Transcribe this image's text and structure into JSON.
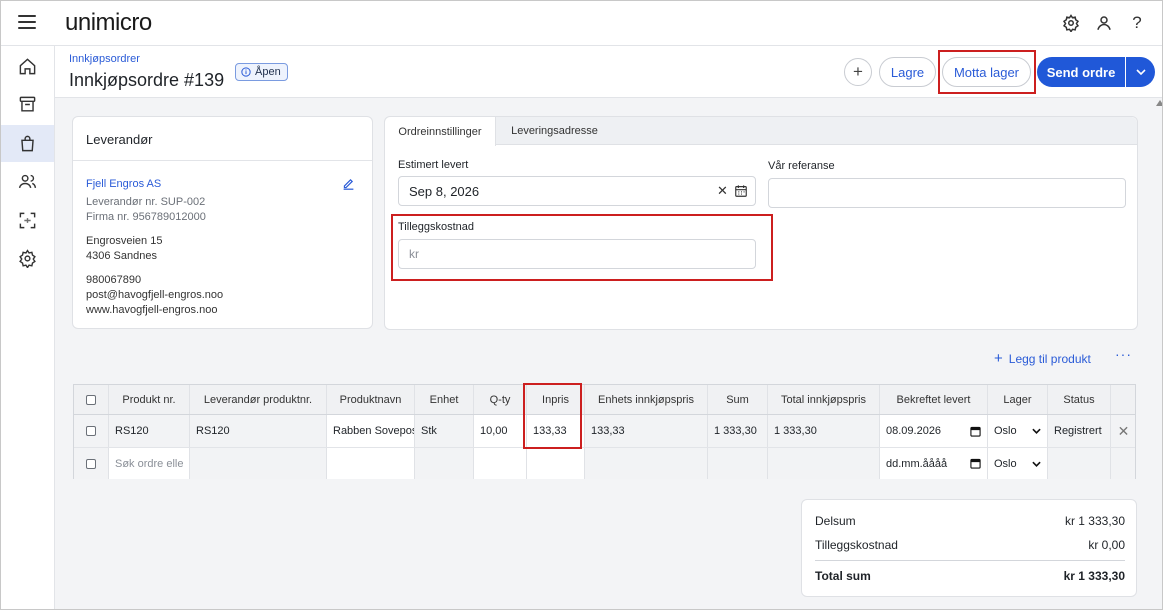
{
  "app": {
    "logo": "unimicro"
  },
  "header": {
    "breadcrumb": "Innkjøpsordrer",
    "title": "Innkjøpsordre #139",
    "status": "Åpen",
    "buttons": {
      "plus": "+",
      "save": "Lagre",
      "receive": "Motta lager",
      "send": "Send ordre"
    }
  },
  "supplier": {
    "title": "Leverandør",
    "name": "Fjell Engros AS",
    "supplier_no": "Leverandør nr. SUP-002",
    "org_no": "Firma nr. 956789012000",
    "street": "Engrosveien 15",
    "postal": "4306 Sandnes",
    "phone": "980067890",
    "email": "post@havogfjell-engros.noo",
    "web": "www.havogfjell-engros.noo"
  },
  "settings": {
    "tabs": [
      "Ordreinnstillinger",
      "Leveringsadresse"
    ],
    "estimated_label": "Estimert levert",
    "estimated_value": "Sep 8, 2026",
    "clear_symbol": "✕",
    "reference_label": "Vår referanse",
    "reference_value": "",
    "extra_cost_label": "Tilleggskostnad",
    "extra_cost_placeholder": "kr"
  },
  "actions": {
    "add_product": "Legg til produkt",
    "more": "···"
  },
  "table": {
    "columns": [
      "Produkt nr.",
      "Leverandør produktnr.",
      "Produktnavn",
      "Enhet",
      "Q-ty",
      "Inpris",
      "Enhets innkjøpspris",
      "Sum",
      "Total innkjøpspris",
      "Bekreftet levert",
      "Lager",
      "Status"
    ],
    "row": {
      "product_no": "RS120",
      "supplier_product_no": "RS120",
      "name": "Rabben Sovepose",
      "unit": "Stk",
      "qty": "10,00",
      "in_price": "133,33",
      "unit_purchase_price": "133,33",
      "sum": "1 333,30",
      "total_purchase_price": "1 333,30",
      "confirmed_delivery": "08.09.2026",
      "warehouse": "Oslo",
      "status": "Registrert"
    },
    "new_row": {
      "search_placeholder": "Søk ordre elle",
      "date_placeholder": "dd.mm.åååå",
      "warehouse": "Oslo"
    }
  },
  "totals": {
    "subtotal_label": "Delsum",
    "subtotal_value": "kr 1 333,30",
    "extra_label": "Tilleggskostnad",
    "extra_value": "kr 0,00",
    "total_label": "Total sum",
    "total_value": "kr 1 333,30"
  }
}
